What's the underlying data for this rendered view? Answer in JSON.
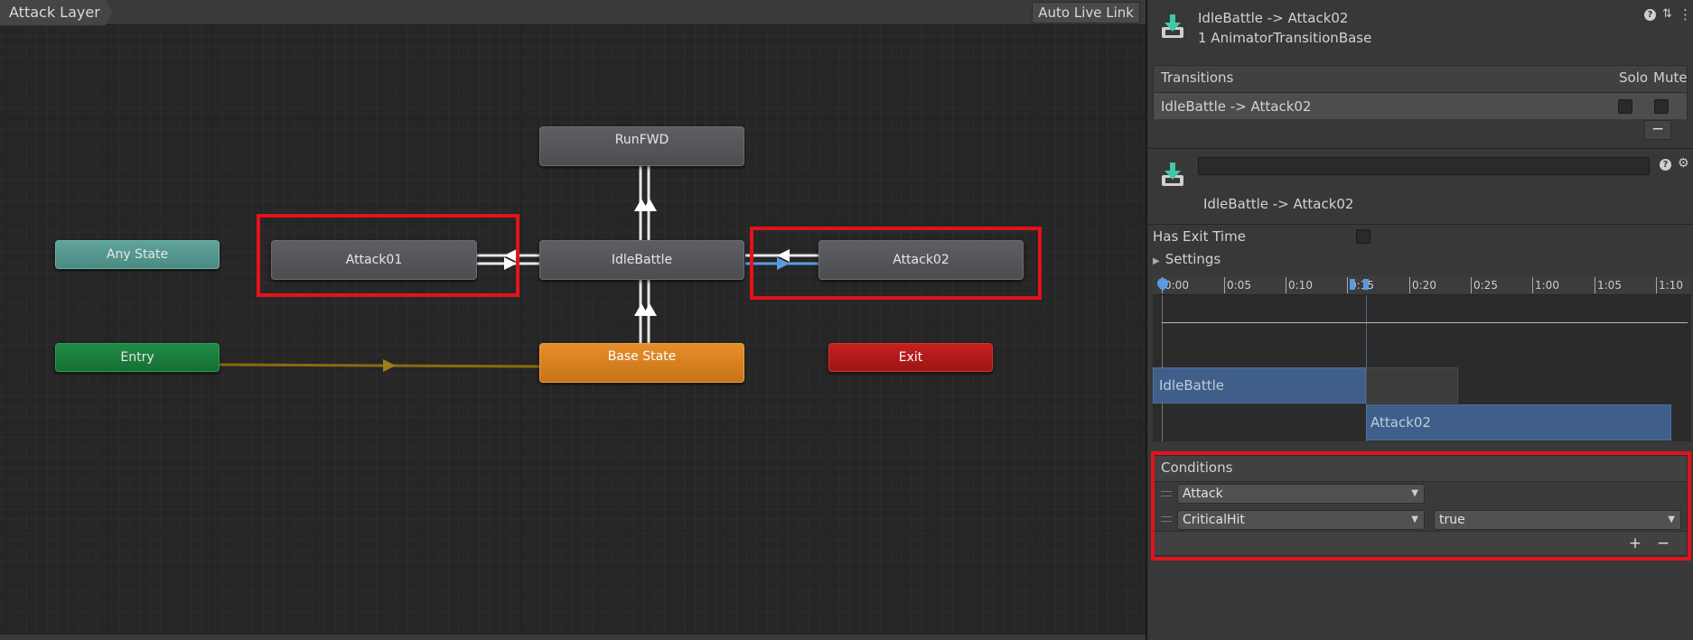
{
  "graph": {
    "layer_name": "Attack Layer",
    "auto_live_link_label": "Auto Live Link",
    "states": {
      "run_fwd": "RunFWD",
      "attack01": "Attack01",
      "idle_battle": "IdleBattle",
      "attack02": "Attack02",
      "any_state": "Any State",
      "entry": "Entry",
      "base_state": "Base State",
      "exit": "Exit"
    },
    "colors": {
      "state_gray": "#555759",
      "any_state": "#549990",
      "entry": "#1c7f3f",
      "base_state": "#d9801f",
      "exit": "#b31a1a",
      "selected_transition": "#5a9be0",
      "entry_transition": "#8a6a12",
      "highlight": "#e3121b"
    }
  },
  "inspector": {
    "title": "IdleBattle -> Attack02",
    "subtitle": "1 AnimatorTransitionBase",
    "transitions": {
      "header": "Transitions",
      "solo_label": "Solo",
      "mute_label": "Mute",
      "rows": [
        {
          "label": "IdleBattle -> Attack02"
        }
      ],
      "remove_label": "−"
    },
    "transition_detail": {
      "name_value": "",
      "label": "IdleBattle -> Attack02"
    },
    "has_exit_time_label": "Has Exit Time",
    "settings_label": "Settings",
    "timeline": {
      "ticks": [
        "0:00",
        "0:05",
        "0:10",
        "0:15",
        "0:20",
        "0:25",
        "1:00",
        "1:05",
        "1:10"
      ],
      "source_clip": "IdleBattle",
      "destination_clip": "Attack02"
    },
    "conditions": {
      "header": "Conditions",
      "rows": [
        {
          "parameter": "Attack",
          "value": ""
        },
        {
          "parameter": "CriticalHit",
          "value": "true"
        }
      ],
      "add_label": "+",
      "remove_label": "−"
    }
  }
}
